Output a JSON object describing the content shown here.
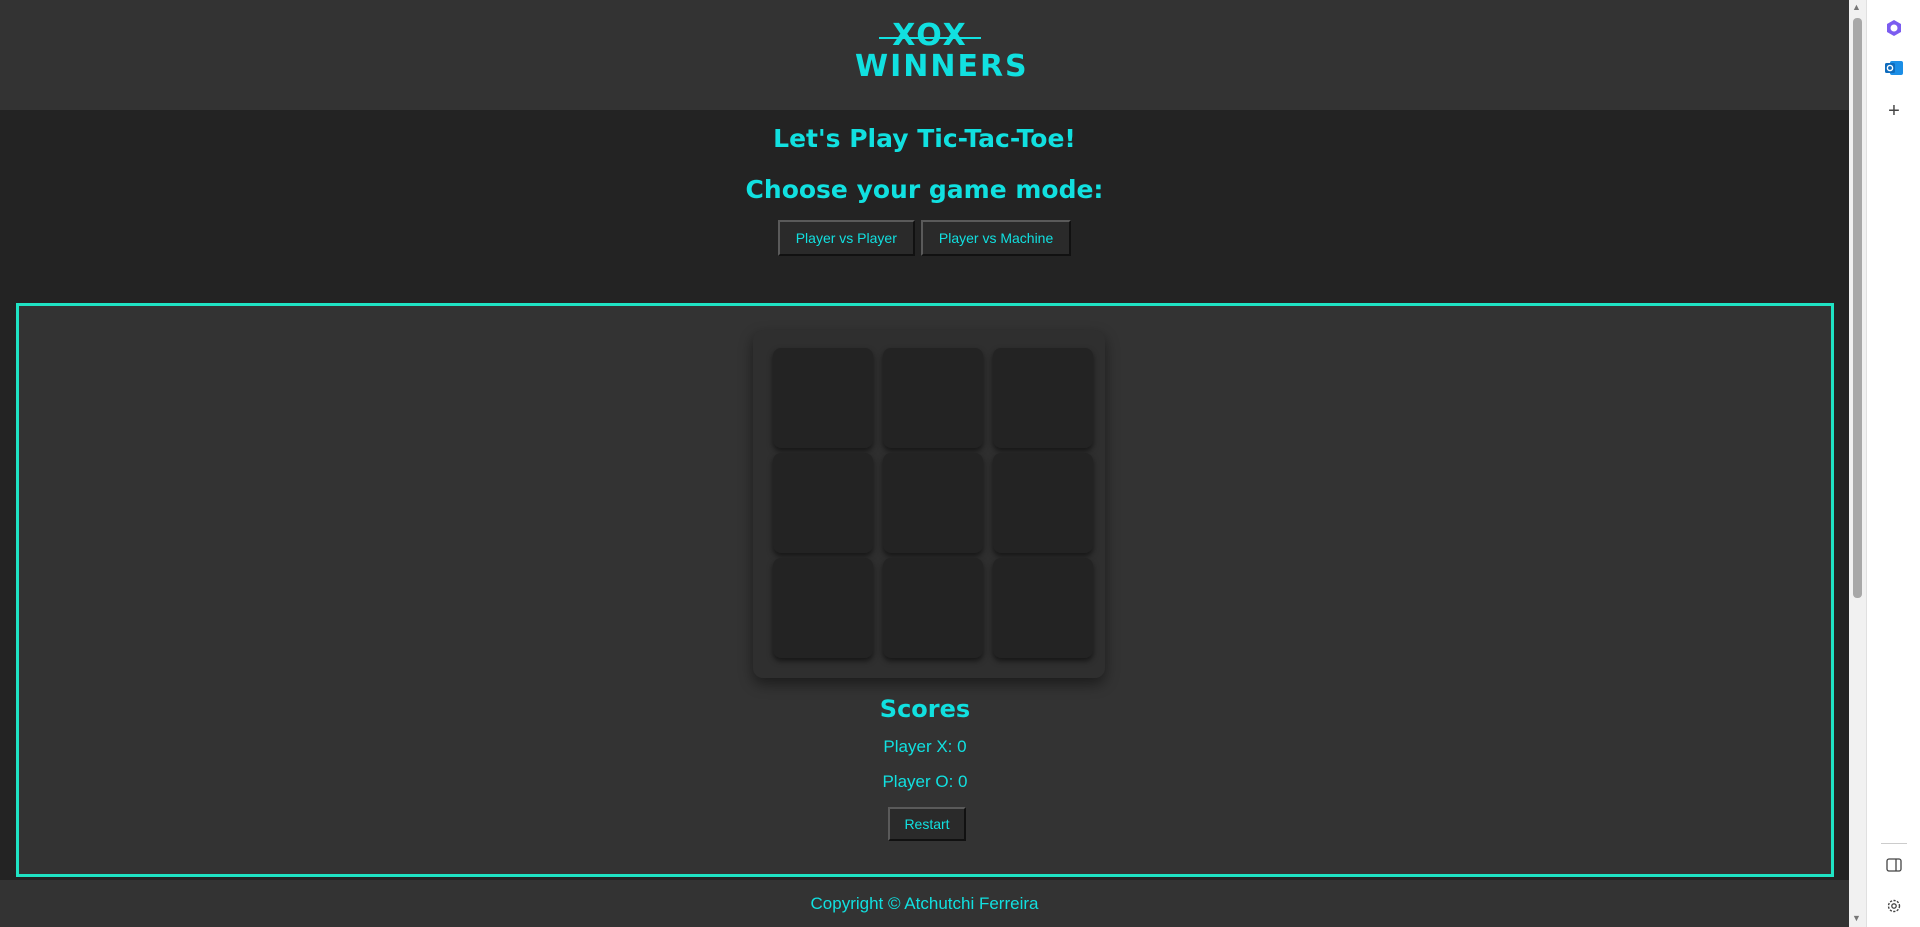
{
  "header": {
    "logo_top": "XOX",
    "logo_bottom": "WINNERS"
  },
  "intro": {
    "title": "Let's Play Tic-Tac-Toe!",
    "mode_prompt": "Choose your game mode:"
  },
  "modes": {
    "pvp_label": "Player vs Player",
    "pvm_label": "Player vs Machine"
  },
  "board": {
    "cells": [
      "",
      "",
      "",
      "",
      "",
      "",
      "",
      "",
      ""
    ]
  },
  "scores": {
    "title": "Scores",
    "player_x": "Player X: 0",
    "player_o": "Player O: 0",
    "restart_label": "Restart"
  },
  "footer": {
    "copyright": "Copyright © Atchutchi Ferreira"
  },
  "browser_sidebar": {
    "icons": [
      "copilot-icon",
      "outlook-icon",
      "add-icon",
      "split-screen-icon",
      "settings-icon"
    ]
  },
  "colors": {
    "accent": "#11e0e0",
    "panel_border": "#1fe3c4",
    "background": "#232323",
    "panel": "#333333"
  }
}
